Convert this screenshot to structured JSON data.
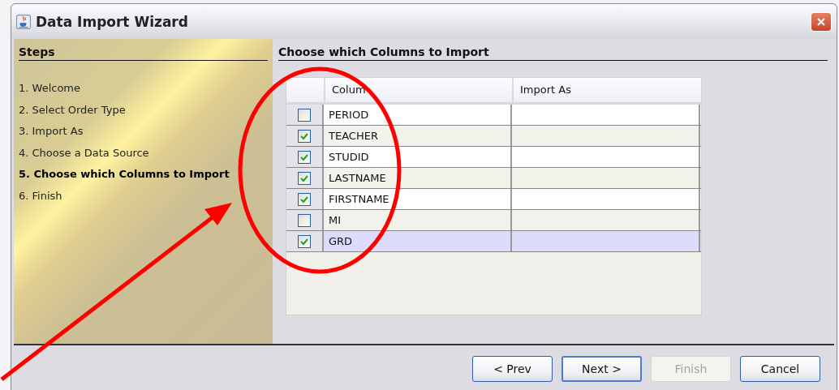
{
  "window": {
    "title": "Data Import Wizard"
  },
  "steps_panel": {
    "heading": "Steps",
    "steps": [
      {
        "label": "1. Welcome",
        "selected": false
      },
      {
        "label": "2. Select Order Type",
        "selected": false
      },
      {
        "label": "3. Import As",
        "selected": false
      },
      {
        "label": "4. Choose a Data Source",
        "selected": false
      },
      {
        "label": "5. Choose which Columns to Import",
        "selected": true
      },
      {
        "label": "6. Finish",
        "selected": false
      }
    ]
  },
  "content": {
    "heading": "Choose which Columns to Import",
    "table": {
      "columns": [
        "Colum",
        "Import As"
      ],
      "rows": [
        {
          "column": "PERIOD",
          "checked": false,
          "selected": false
        },
        {
          "column": "TEACHER",
          "checked": true,
          "selected": false
        },
        {
          "column": "STUDID",
          "checked": true,
          "selected": false
        },
        {
          "column": "LASTNAME",
          "checked": true,
          "selected": false
        },
        {
          "column": "FIRSTNAME",
          "checked": true,
          "selected": false
        },
        {
          "column": "MI",
          "checked": false,
          "selected": false
        },
        {
          "column": "GRD",
          "checked": true,
          "selected": true
        }
      ]
    }
  },
  "buttons": [
    {
      "label": "< Prev",
      "disabled": false,
      "default": false
    },
    {
      "label": "Next >",
      "disabled": false,
      "default": true
    },
    {
      "label": "Finish",
      "disabled": true,
      "default": false
    },
    {
      "label": "Cancel",
      "disabled": false,
      "default": false
    }
  ]
}
